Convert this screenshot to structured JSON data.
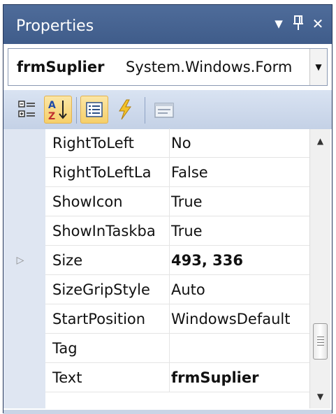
{
  "panel": {
    "title": "Properties",
    "buttons": {
      "dropdown": "▼",
      "pin": "ᚢ",
      "close": "✕"
    }
  },
  "object_selector": {
    "name": "frmSuplier",
    "type": "System.Windows.Form",
    "dropdown_arrow": "▼"
  },
  "toolbar": {
    "tools": [
      {
        "name": "categorized-icon",
        "active": false
      },
      {
        "name": "alphabetical-icon",
        "active": true
      },
      {
        "name": "properties-icon",
        "active": true
      },
      {
        "name": "events-icon",
        "active": false
      },
      {
        "name": "property-pages-icon",
        "active": false
      }
    ]
  },
  "properties": [
    {
      "name": "RightToLeft",
      "value": "No",
      "bold": false,
      "expandable": false
    },
    {
      "name": "RightToLeftLa",
      "value": "False",
      "bold": false,
      "expandable": false
    },
    {
      "name": "ShowIcon",
      "value": "True",
      "bold": false,
      "expandable": false
    },
    {
      "name": "ShowInTaskba",
      "value": "True",
      "bold": false,
      "expandable": false
    },
    {
      "name": "Size",
      "value": "493, 336",
      "bold": true,
      "expandable": true
    },
    {
      "name": "SizeGripStyle",
      "value": "Auto",
      "bold": false,
      "expandable": false
    },
    {
      "name": "StartPosition",
      "value": "WindowsDefault",
      "bold": false,
      "expandable": false
    },
    {
      "name": "Tag",
      "value": "",
      "bold": false,
      "expandable": false
    },
    {
      "name": "Text",
      "value": "frmSuplier",
      "bold": true,
      "expandable": false
    }
  ],
  "expander_glyph": "▷",
  "scrollbar": {
    "up": "▲",
    "down": "▼"
  },
  "colors": {
    "title_bg": "#3f5c8a",
    "toolbar_bg": "#c4d1e6",
    "active_tool": "#f6cf6a",
    "grid_margin": "#dfe6f2"
  }
}
